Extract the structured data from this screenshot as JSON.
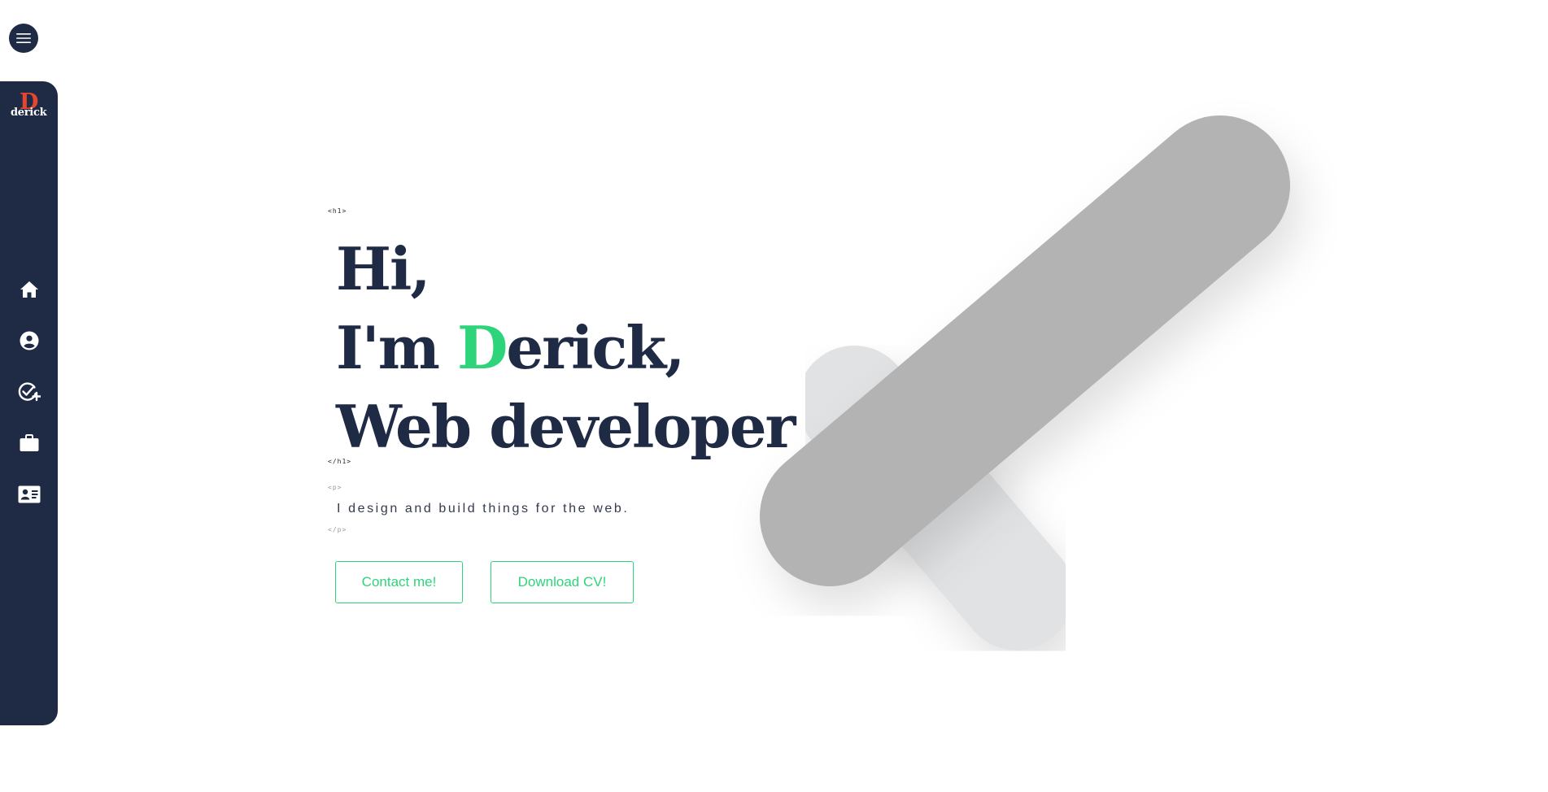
{
  "menu": {
    "icon": "hamburger-menu-icon"
  },
  "sidebar": {
    "logo_letter": "D",
    "logo_word": "derick",
    "items": [
      {
        "icon": "home-icon"
      },
      {
        "icon": "user-circle-icon"
      },
      {
        "icon": "check-add-icon"
      },
      {
        "icon": "briefcase-icon"
      },
      {
        "icon": "contact-card-icon"
      }
    ]
  },
  "hero": {
    "tag_h1_open": "<h1>",
    "line1": "Hi,",
    "line2_prefix": "I'm ",
    "line2_accent": "D",
    "line2_suffix": "erick,",
    "line3": "Web developer",
    "tag_h1_close": "</h1>",
    "tag_p_open": "<p>",
    "intro": "I design and build things for the web.",
    "tag_p_close": "</p>",
    "contact_label": "Contact me!",
    "cv_label": "Download CV!"
  },
  "colors": {
    "navy": "#1f2a44",
    "accent": "#2ed47a",
    "logo_red": "#e4472f",
    "art_dark": "#b3b3b3",
    "art_light": "#e1e2e4"
  }
}
